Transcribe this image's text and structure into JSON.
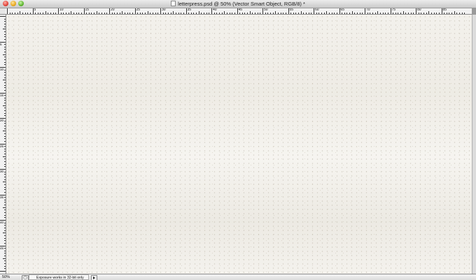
{
  "window": {
    "title": "letterpress.psd @ 50% (Vector Smart Object, RGB/8) *"
  },
  "ruler_top": {
    "labels": [
      "5",
      "10",
      "15",
      "20",
      "25",
      "30",
      "35",
      "40",
      "45",
      "50",
      "55",
      "60",
      "65",
      "70",
      "75",
      "80",
      "85"
    ]
  },
  "ruler_left": {
    "labels": [
      "5",
      "10",
      "15",
      "20",
      "25",
      "30",
      "35",
      "40",
      "45"
    ]
  },
  "status": {
    "zoom": "50%",
    "message": "Exposure works in 32-bit only"
  },
  "icons": {
    "close": "close-icon",
    "minimize": "minimize-icon",
    "zoom": "zoom-icon",
    "document": "document-icon",
    "info": "status-info-icon",
    "menu": "status-menu-arrow-icon"
  }
}
